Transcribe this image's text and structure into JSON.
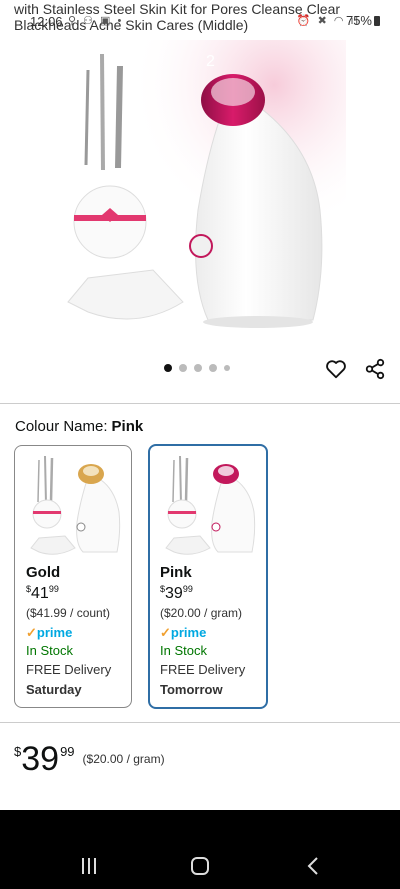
{
  "status_bar": {
    "title_line_1": "with Stainless Steel Skin Kit for Pores Cleanse Clear",
    "title_line_2": "Blackheads Acne Skin Cares (Middle)",
    "time": "12:06",
    "battery": "75%"
  },
  "hero": {
    "image_counter": "2"
  },
  "carousel": {
    "dot_count": 5,
    "active_index": 0
  },
  "colour": {
    "label": "Colour Name:",
    "value": "Pink"
  },
  "swatches": [
    {
      "name": "Gold",
      "price_currency": "$",
      "price_whole": "41",
      "price_fraction": "99",
      "unit_price": "($41.99 / count)",
      "prime": "prime",
      "stock": "In Stock",
      "delivery": "FREE Delivery",
      "day": "Saturday",
      "accent": "#d9a64e"
    },
    {
      "name": "Pink",
      "price_currency": "$",
      "price_whole": "39",
      "price_fraction": "99",
      "unit_price": "($20.00 / gram)",
      "prime": "prime",
      "stock": "In Stock",
      "delivery": "FREE Delivery",
      "day": "Tomorrow",
      "accent": "#c2185b"
    }
  ],
  "price": {
    "currency": "$",
    "whole": "39",
    "fraction": "99",
    "per_unit": "($20.00 / gram)"
  },
  "colors": {
    "selected_border": "#2f6ea5",
    "in_stock": "#007600",
    "prime_blue": "#00a8e1"
  }
}
